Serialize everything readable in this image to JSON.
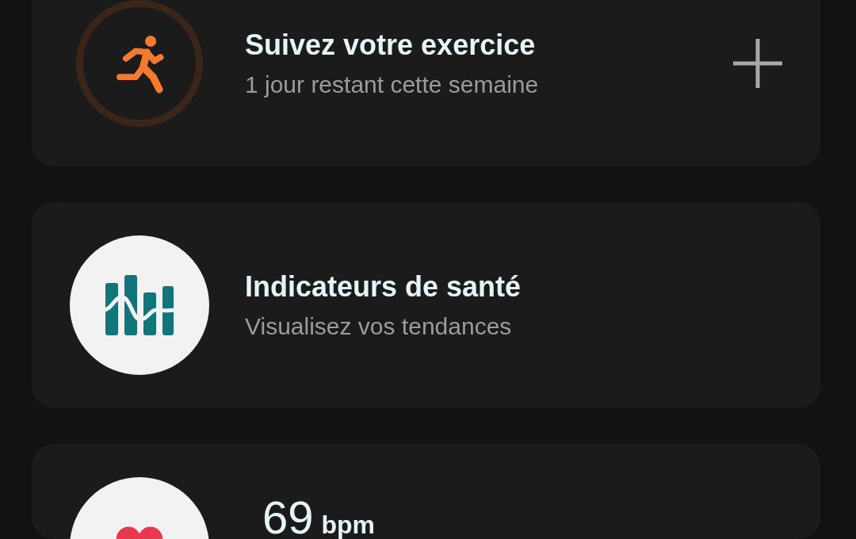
{
  "cards": [
    {
      "kind": "exercise",
      "title": "Suivez votre exercice",
      "subtitle": "1 jour restant cette semaine",
      "add_button": true
    },
    {
      "kind": "metrics",
      "title": "Indicateurs de santé",
      "subtitle": "Visualisez vos tendances",
      "add_button": false
    },
    {
      "kind": "heart_rate",
      "value": "69",
      "unit": "bpm",
      "add_button": false
    }
  ]
}
